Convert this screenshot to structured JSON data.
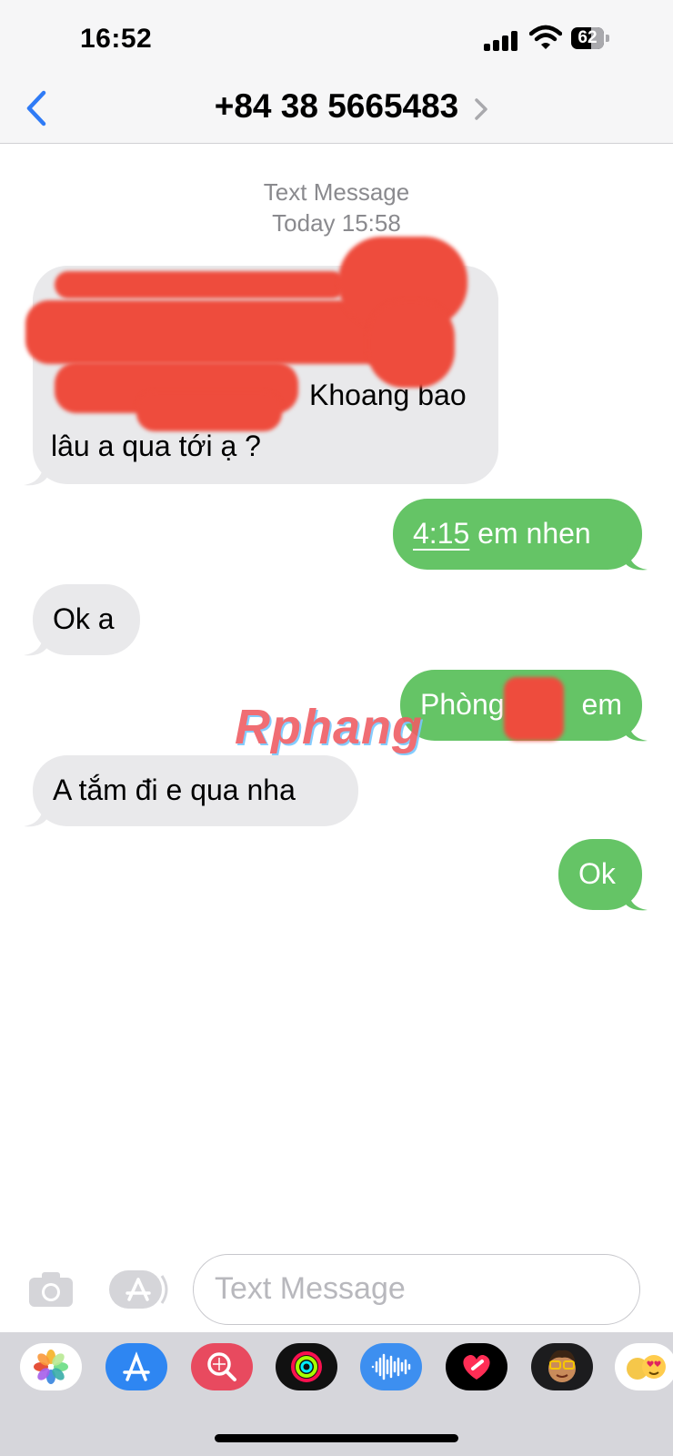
{
  "status_bar": {
    "time": "16:52",
    "battery": "62"
  },
  "header": {
    "contact": "+84 38 5665483"
  },
  "thread": {
    "service": "Text Message",
    "timestamp": "Today 15:58"
  },
  "messages": [
    {
      "from": "them",
      "text": "Khoảng bao lâu a qua tới ạ ?"
    },
    {
      "from": "me",
      "time_link": "4:15",
      "text": " em nhen"
    },
    {
      "from": "them",
      "text": "Ok a"
    },
    {
      "from": "me",
      "text": "Phòng em"
    },
    {
      "from": "them",
      "text": "A tắm đi e qua nha"
    },
    {
      "from": "me",
      "text": "Ok"
    }
  ],
  "message_lines": {
    "m1_line3_tail": "Khoang bao",
    "m1_line4": "lâu a qua tới ạ ?",
    "m4_left": "Phòng",
    "m4_right": "em"
  },
  "composer": {
    "placeholder": "Text Message"
  },
  "watermark": "Rphang",
  "apps": [
    "photos-app-icon",
    "app-store-icon",
    "search-images-icon",
    "activity-icon",
    "voice-memos-icon",
    "digital-touch-icon",
    "memoji-icon",
    "animoji-icon"
  ],
  "colors": {
    "incoming": "#e9e9eb",
    "outgoing": "#65c466",
    "accent": "#2f7bf6",
    "redaction": "#ee4c3d"
  }
}
